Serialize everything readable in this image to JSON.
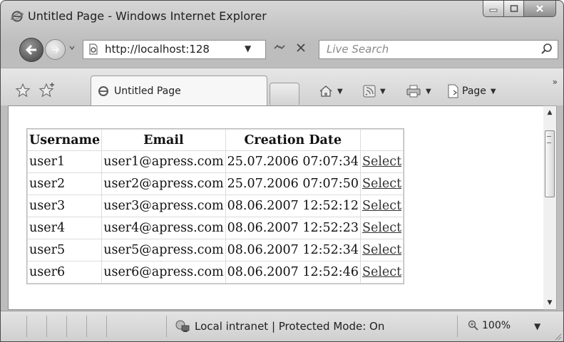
{
  "window": {
    "title": "Untitled Page - Windows Internet Explorer"
  },
  "nav": {
    "address_url": "http://localhost:128",
    "search_placeholder": "Live Search"
  },
  "command_bar": {
    "tab_label": "Untitled Page",
    "page_menu_label": "Page",
    "overflow_glyph": "»"
  },
  "grid": {
    "columns": [
      "Username",
      "Email",
      "Creation Date",
      ""
    ],
    "rows": [
      {
        "username": "user1",
        "email": "user1@apress.com",
        "created": "25.07.2006 07:07:34",
        "action": "Select"
      },
      {
        "username": "user2",
        "email": "user2@apress.com",
        "created": "25.07.2006 07:07:50",
        "action": "Select"
      },
      {
        "username": "user3",
        "email": "user3@apress.com",
        "created": "08.06.2007 12:52:12",
        "action": "Select"
      },
      {
        "username": "user4",
        "email": "user4@apress.com",
        "created": "08.06.2007 12:52:23",
        "action": "Select"
      },
      {
        "username": "user5",
        "email": "user5@apress.com",
        "created": "08.06.2007 12:52:34",
        "action": "Select"
      },
      {
        "username": "user6",
        "email": "user6@apress.com",
        "created": "08.06.2007 12:52:46",
        "action": "Select"
      }
    ]
  },
  "status_bar": {
    "zone_text": "Local intranet | Protected Mode: On",
    "zoom_text": "100%"
  }
}
